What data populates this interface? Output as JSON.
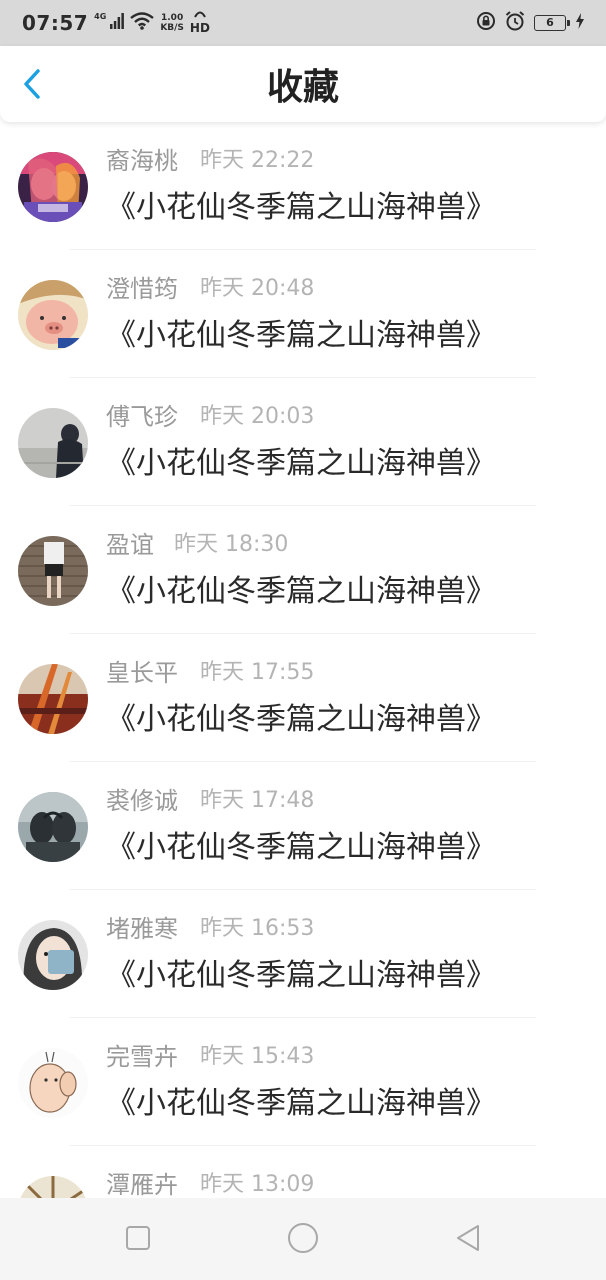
{
  "status_bar": {
    "time": "07:57",
    "network_type": "4G",
    "speed_value": "1.00",
    "speed_unit": "KB/S",
    "hd": "HD",
    "battery_level": "6"
  },
  "header": {
    "title": "收藏",
    "back_icon": "chevron-left-icon",
    "accent_color": "#1ba1e2"
  },
  "favorites": [
    {
      "user": "裔海桃",
      "time": "昨天 22:22",
      "title": "《小花仙冬季篇之山海神兽》"
    },
    {
      "user": "澄惜筠",
      "time": "昨天 20:48",
      "title": "《小花仙冬季篇之山海神兽》"
    },
    {
      "user": "傅飞珍",
      "time": "昨天 20:03",
      "title": "《小花仙冬季篇之山海神兽》"
    },
    {
      "user": "盈谊",
      "time": "昨天 18:30",
      "title": "《小花仙冬季篇之山海神兽》"
    },
    {
      "user": "皇长平",
      "time": "昨天 17:55",
      "title": "《小花仙冬季篇之山海神兽》"
    },
    {
      "user": "裘修诚",
      "time": "昨天 17:48",
      "title": "《小花仙冬季篇之山海神兽》"
    },
    {
      "user": "堵雅寒",
      "time": "昨天 16:53",
      "title": "《小花仙冬季篇之山海神兽》"
    },
    {
      "user": "完雪卉",
      "time": "昨天 15:43",
      "title": "《小花仙冬季篇之山海神兽》"
    },
    {
      "user": "潭雁卉",
      "time": "昨天 13:09",
      "title": ""
    }
  ],
  "nav_bar": {
    "icons": [
      "recent-apps-icon",
      "home-icon",
      "back-icon"
    ]
  }
}
